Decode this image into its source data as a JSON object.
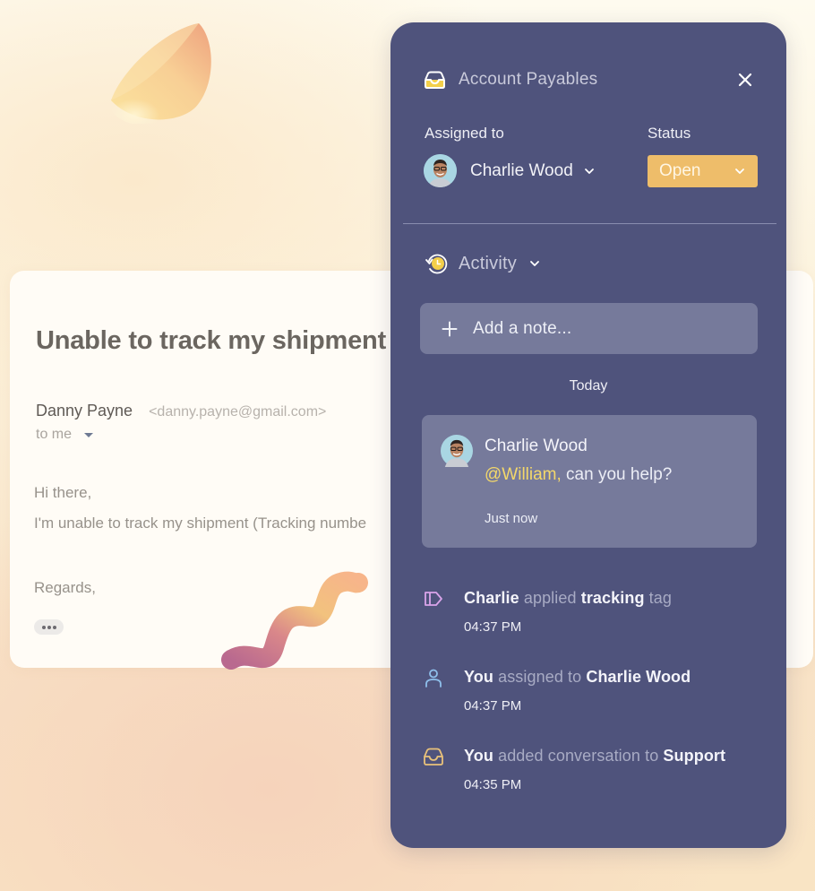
{
  "email": {
    "subject": "Unable to track my shipment",
    "sender_name": "Danny Payne",
    "sender_email": "<danny.payne@gmail.com>",
    "recipient": "to me",
    "body_greeting": "Hi there,",
    "body_line": "I'm unable to track my shipment (Tracking numbe",
    "body_closing": "Regards,"
  },
  "panel": {
    "title": "Account Payables",
    "assigned_label": "Assigned to",
    "assignee": "Charlie Wood",
    "status_label": "Status",
    "status_value": "Open",
    "activity_label": "Activity",
    "note_placeholder": "Add a note...",
    "day_header": "Today",
    "comment": {
      "author": "Charlie Wood",
      "mention": "@William,",
      "text": " can you help?",
      "time": "Just now"
    },
    "events": [
      {
        "icon": "tag-icon",
        "parts": [
          {
            "text": "Charlie",
            "style": "strong"
          },
          {
            "text": "applied",
            "style": "muted"
          },
          {
            "text": "tracking",
            "style": "strong"
          },
          {
            "text": "tag",
            "style": "muted"
          }
        ],
        "time": "04:37 PM"
      },
      {
        "icon": "user-icon",
        "parts": [
          {
            "text": "You",
            "style": "strong"
          },
          {
            "text": "assigned to",
            "style": "muted"
          },
          {
            "text": "Charlie Wood",
            "style": "strong"
          }
        ],
        "time": "04:37 PM"
      },
      {
        "icon": "inbox-icon",
        "parts": [
          {
            "text": "You",
            "style": "strong"
          },
          {
            "text": "added conversation to",
            "style": "muted"
          },
          {
            "text": "Support",
            "style": "strong"
          }
        ],
        "time": "04:35 PM"
      }
    ]
  },
  "colors": {
    "panel_bg": "#4f537c",
    "status_open": "#eebd6a",
    "mention": "#f4d86a",
    "tag_icon": "#d9a4ea",
    "user_icon": "#8fc0ec",
    "inbox_icon": "#e9c27a"
  }
}
